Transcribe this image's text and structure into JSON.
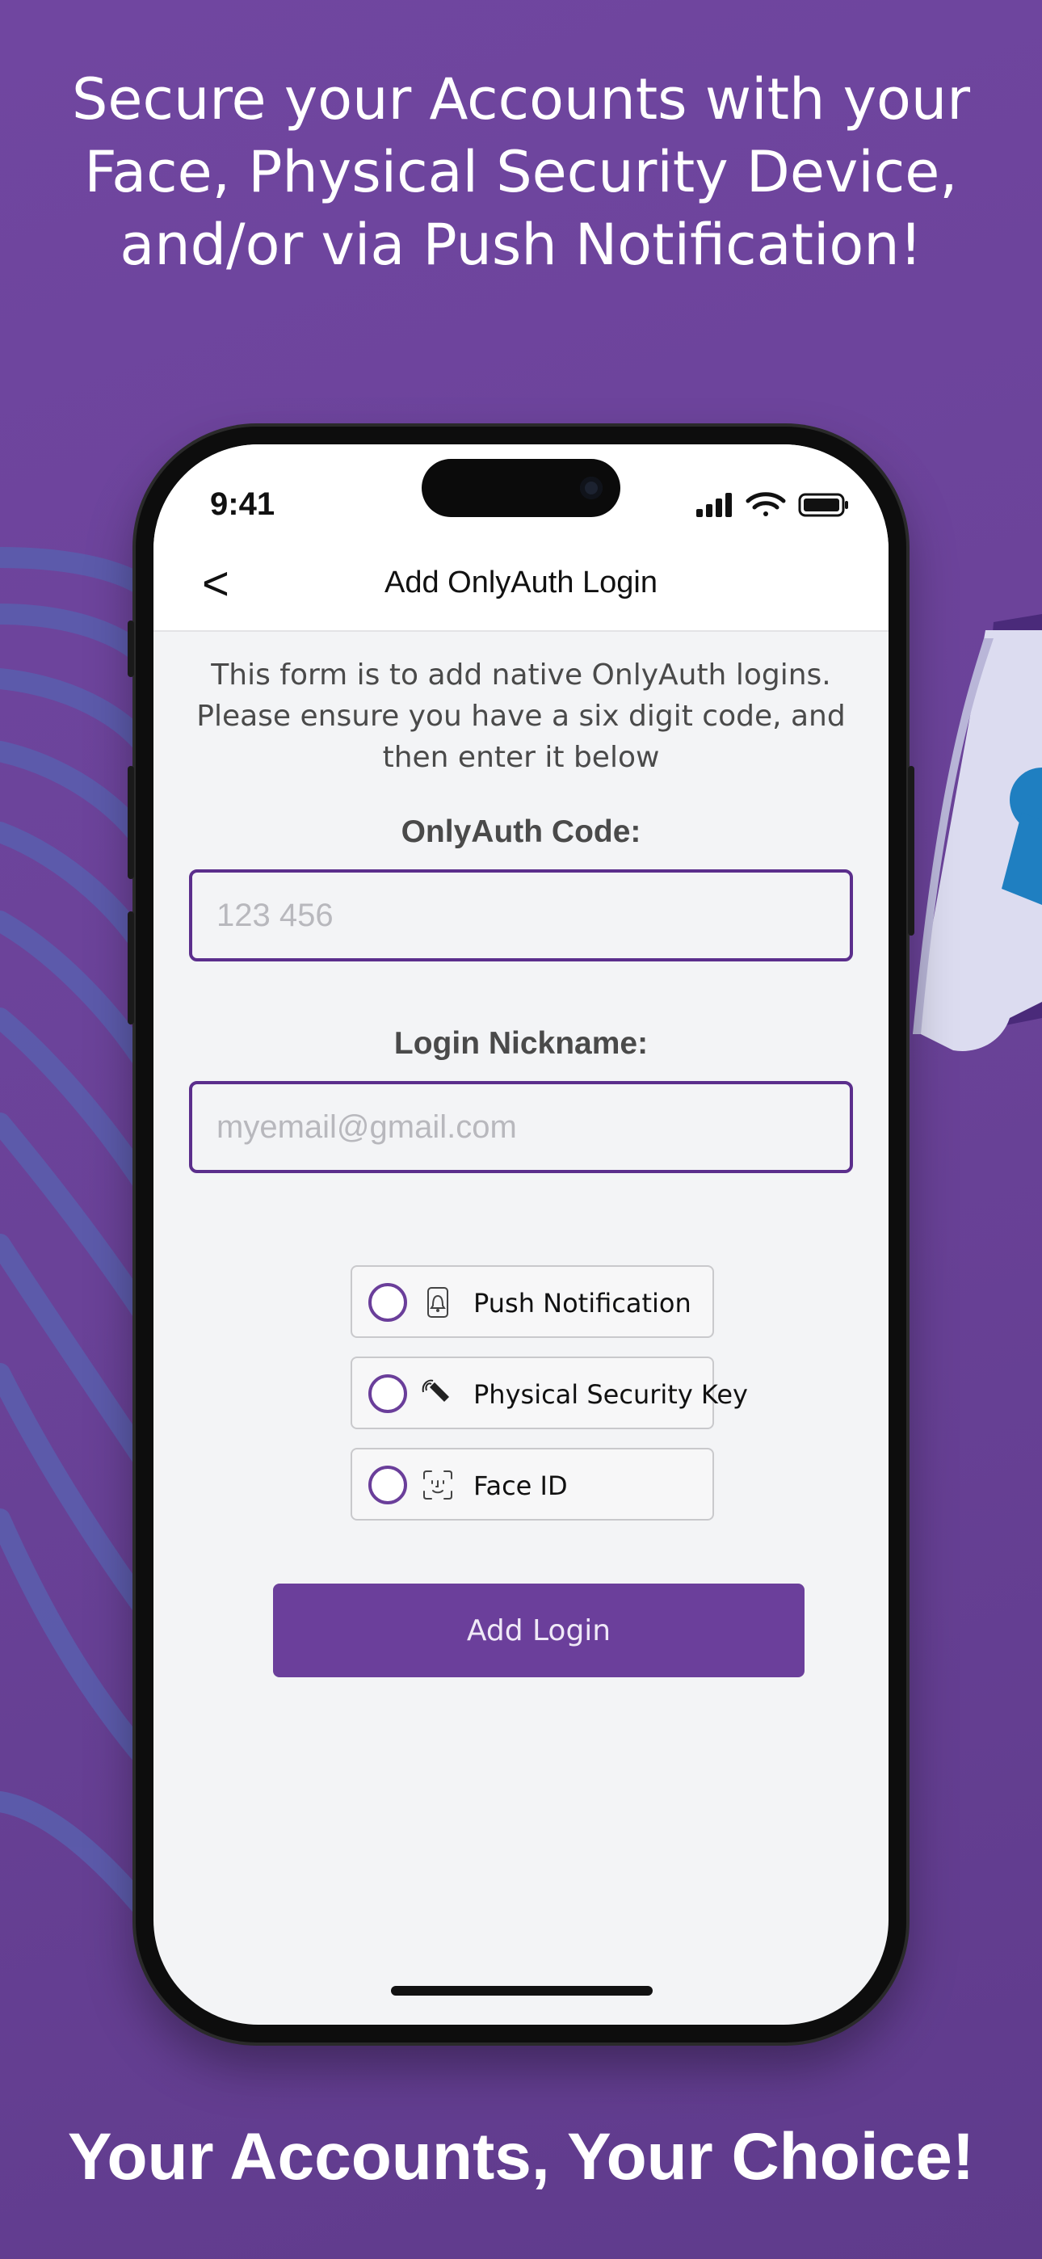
{
  "promo": {
    "headline": "Secure your Accounts with your Face, Physical Security Device, and/or via Push Notification!",
    "footer": "Your Accounts, Your Choice!"
  },
  "status_bar": {
    "time": "9:41"
  },
  "nav": {
    "back_label": "<",
    "title": "Add OnlyAuth Login"
  },
  "form": {
    "intro": "This form is to add native OnlyAuth logins. Please ensure you have a six digit code, and then enter it below",
    "code": {
      "label": "OnlyAuth Code:",
      "placeholder": "123 456",
      "value": ""
    },
    "nickname": {
      "label": "Login Nickname:",
      "placeholder": "myemail@gmail.com",
      "value": ""
    },
    "options": [
      {
        "label": "Push Notification",
        "icon": "push-notification-icon",
        "selected": false
      },
      {
        "label": "Physical Security Key",
        "icon": "security-key-icon",
        "selected": false
      },
      {
        "label": "Face ID",
        "icon": "face-id-icon",
        "selected": false
      }
    ],
    "submit_label": "Add Login"
  },
  "colors": {
    "background": "#6a4298",
    "accent": "#6b3f9b",
    "input_border": "#5b2e8c",
    "lock_blue": "#1f7fc1"
  }
}
